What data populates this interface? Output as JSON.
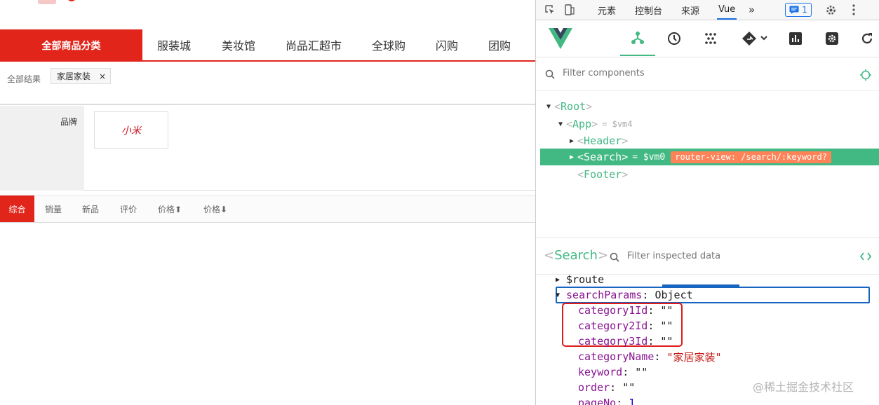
{
  "page": {
    "nav": {
      "all_categories": "全部商品分类",
      "items": [
        "服装城",
        "美妆馆",
        "尚品汇超市",
        "全球购",
        "闪购",
        "团购"
      ]
    },
    "breadcrumb": {
      "label": "全部结果",
      "tag": "家居家装",
      "close": "×"
    },
    "brand": {
      "key": "品牌",
      "logo_text": "小米"
    },
    "sort": [
      "综合",
      "销量",
      "新品",
      "评价",
      "价格⬆",
      "价格⬇"
    ]
  },
  "devtools": {
    "tabs": [
      "元素",
      "控制台",
      "来源",
      "Vue"
    ],
    "active_tab": "Vue",
    "more": "»",
    "message_count": "1",
    "component_filter_placeholder": "Filter components",
    "tree": [
      {
        "tag": "Root",
        "depth": 0,
        "expanded": true
      },
      {
        "tag": "App",
        "vm": "= $vm4",
        "depth": 1,
        "expanded": true
      },
      {
        "tag": "Header",
        "depth": 2,
        "expanded": false
      },
      {
        "tag": "Search",
        "vm": "= $vm0",
        "route": "router-view: /search/:keyword?",
        "depth": 2,
        "expanded": false,
        "selected": true
      },
      {
        "tag": "Footer",
        "depth": 2
      }
    ],
    "inspector": {
      "component": "Search",
      "filter_placeholder": "Filter inspected data",
      "rows": [
        {
          "key": "$route",
          "value": "",
          "depth": 0,
          "arrow": "▶"
        },
        {
          "key": "searchParams",
          "value": "Object",
          "depth": 0,
          "arrow": "▼"
        },
        {
          "key": "category1Id",
          "value": "\"\"",
          "depth": 1
        },
        {
          "key": "category2Id",
          "value": "\"\"",
          "depth": 1
        },
        {
          "key": "category3Id",
          "value": "\"\"",
          "depth": 1
        },
        {
          "key": "categoryName",
          "value": "\"家居家装\"",
          "depth": 1
        },
        {
          "key": "keyword",
          "value": "\"\"",
          "depth": 1
        },
        {
          "key": "order",
          "value": "\"\"",
          "depth": 1
        },
        {
          "key": "pageNo",
          "value": "1",
          "depth": 1
        }
      ]
    },
    "watermark": "@稀土掘金技术社区"
  }
}
